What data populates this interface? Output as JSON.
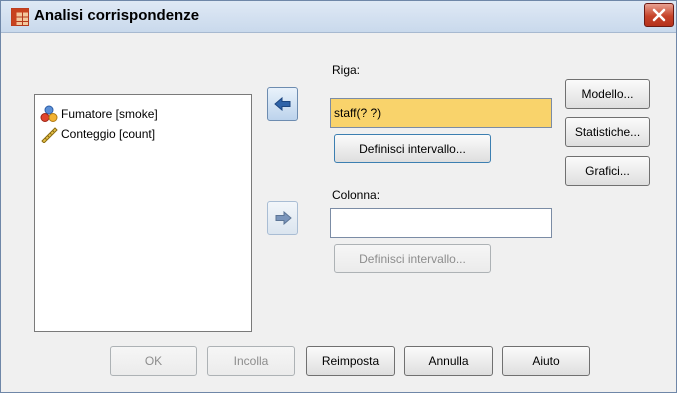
{
  "window": {
    "title": "Analisi corrispondenze"
  },
  "variables": [
    {
      "label": "Fumatore [smoke]",
      "icon": "nominal-icon"
    },
    {
      "label": "Conteggio [count]",
      "icon": "scale-icon"
    }
  ],
  "row": {
    "label": "Riga:",
    "value": "staff(? ?)",
    "define_range": "Definisci intervallo..."
  },
  "column": {
    "label": "Colonna:",
    "value": "",
    "define_range": "Definisci intervallo..."
  },
  "side_buttons": {
    "model": "Modello...",
    "statistics": "Statistiche...",
    "plots": "Grafici..."
  },
  "bottom_buttons": {
    "ok": "OK",
    "paste": "Incolla",
    "reset": "Reimposta",
    "cancel": "Annulla",
    "help": "Aiuto"
  },
  "colors": {
    "accent": "#f9d36b",
    "titlebar": "#c9d9ec",
    "close": "#c6432a"
  }
}
